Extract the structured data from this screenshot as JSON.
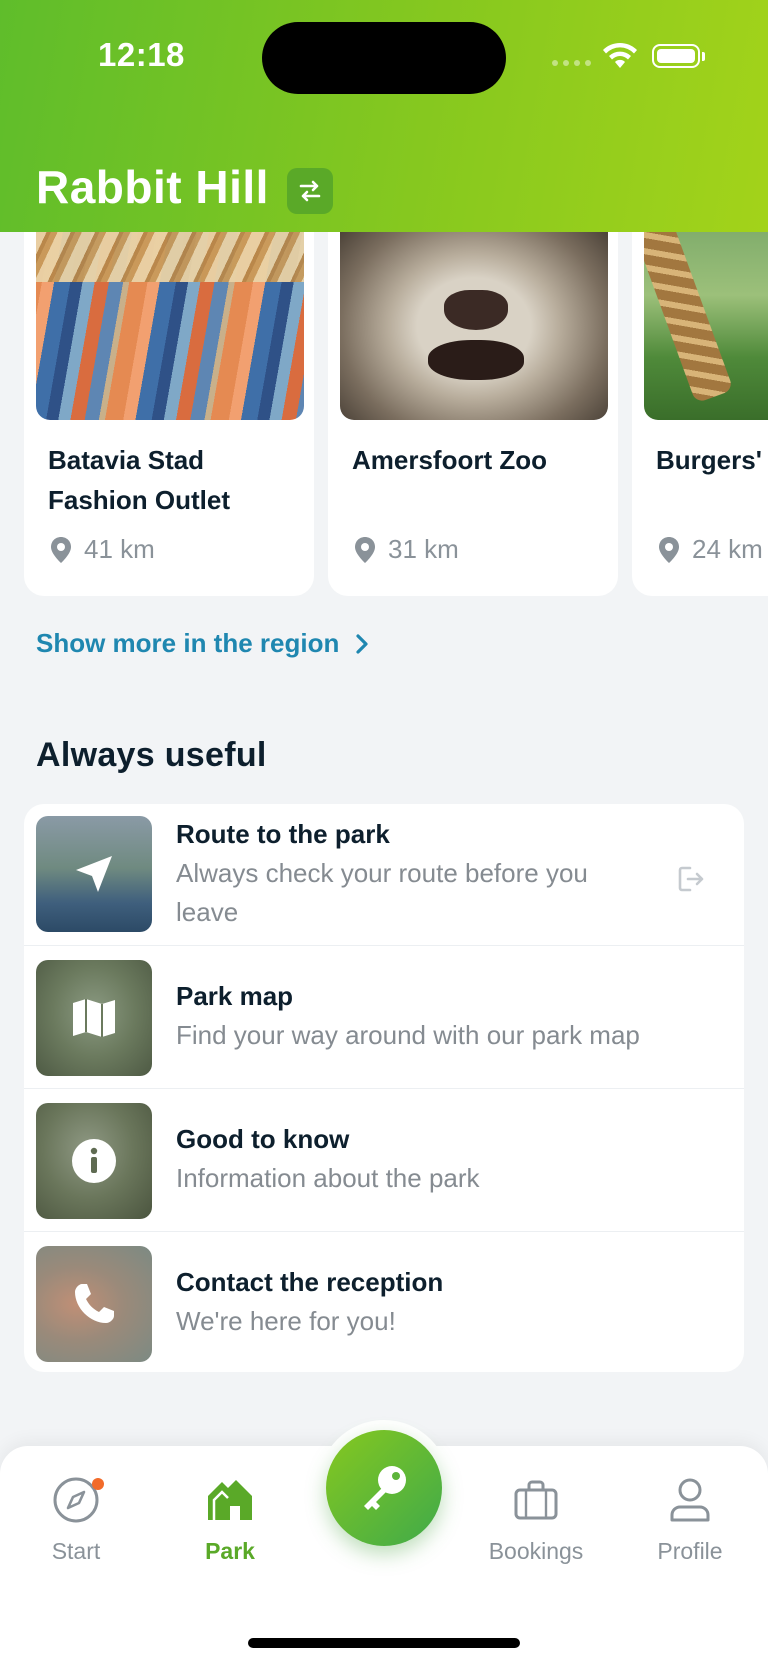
{
  "status_bar": {
    "time": "12:18"
  },
  "header": {
    "park_name": "Rabbit Hill"
  },
  "carousel": [
    {
      "title": "Batavia Stad Fashion Outlet",
      "distance": "41 km"
    },
    {
      "title": "Amersfoort Zoo",
      "distance": "31 km"
    },
    {
      "title": "Burgers'",
      "distance": "24 km"
    }
  ],
  "show_more_label": "Show more in the region",
  "useful": {
    "title": "Always useful",
    "items": [
      {
        "title": "Route to the park",
        "subtitle": "Always check your route before you leave",
        "icon": "navigation-arrow-icon"
      },
      {
        "title": "Park map",
        "subtitle": "Find your way around with our park map",
        "icon": "map-icon"
      },
      {
        "title": "Good to know",
        "subtitle": "Information about the park",
        "icon": "info-icon"
      },
      {
        "title": "Contact the reception",
        "subtitle": "We're here for you!",
        "icon": "phone-icon"
      }
    ]
  },
  "nav": {
    "start": "Start",
    "park": "Park",
    "bookings": "Bookings",
    "profile": "Profile"
  },
  "colors": {
    "brand_green": "#5aa928",
    "link_blue": "#1f87b0",
    "notification_dot": "#f26b2a"
  }
}
